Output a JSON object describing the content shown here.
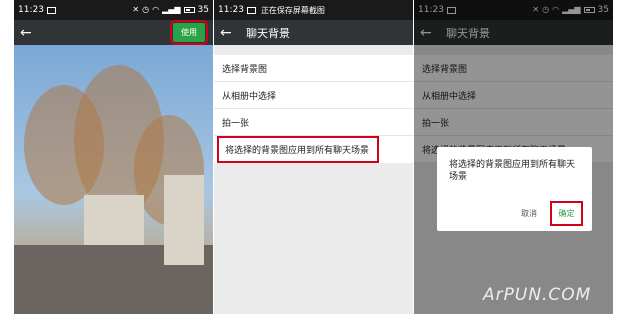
{
  "screens": [
    {
      "status": {
        "time": "11:23",
        "battery": "35"
      },
      "toolbar": {
        "use_label": "使用"
      }
    },
    {
      "status": {
        "time": "11:23",
        "note": "正在保存屏幕截图"
      },
      "toolbar": {
        "title": "聊天背景"
      },
      "menu": [
        {
          "label": "选择背景图"
        },
        {
          "label": "从相册中选择"
        },
        {
          "label": "拍一张"
        },
        {
          "label": "将选择的背景图应用到所有聊天场景"
        }
      ]
    },
    {
      "status": {
        "time": "11:23",
        "battery": "35"
      },
      "toolbar": {
        "title": "聊天背景"
      },
      "menu": [
        {
          "label": "选择背景图"
        },
        {
          "label": "从相册中选择"
        },
        {
          "label": "拍一张"
        },
        {
          "label": "将选择的背景图应用到所有聊天场景"
        }
      ],
      "dialog": {
        "message": "将选择的背景图应用到所有聊天场景",
        "cancel_label": "取消",
        "confirm_label": "确定"
      }
    }
  ],
  "watermark": "ArPUN.COM",
  "colors": {
    "accent_green": "#2ba245",
    "highlight_red": "#d0021b",
    "toolbar": "#303436"
  }
}
